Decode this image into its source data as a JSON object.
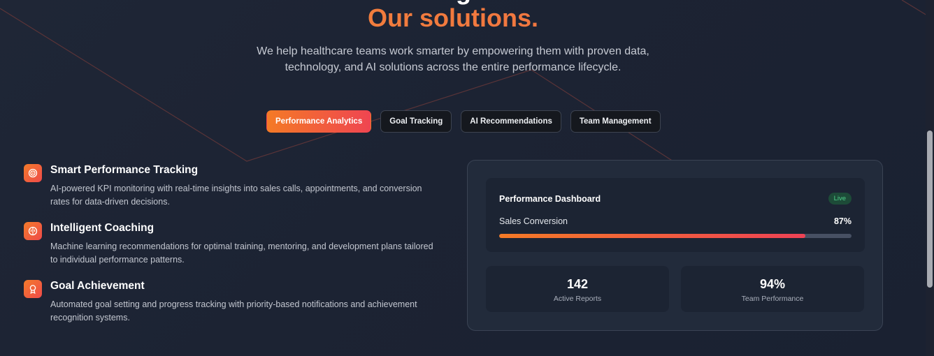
{
  "section": {
    "title": "Our solutions.",
    "subtitle": "We help healthcare teams work smarter by empowering them with proven data, technology, and AI solutions across the entire performance lifecycle."
  },
  "tabs": [
    {
      "label": "Performance Analytics",
      "active": true
    },
    {
      "label": "Goal Tracking",
      "active": false
    },
    {
      "label": "AI Recommendations",
      "active": false
    },
    {
      "label": "Team Management",
      "active": false
    }
  ],
  "features": [
    {
      "icon": "target-icon",
      "title": "Smart Performance Tracking",
      "description": "AI-powered KPI monitoring with real-time insights into sales calls, appointments, and conversion rates for data-driven decisions."
    },
    {
      "icon": "brain-icon",
      "title": "Intelligent Coaching",
      "description": "Machine learning recommendations for optimal training, mentoring, and development plans tailored to individual performance patterns."
    },
    {
      "icon": "award-icon",
      "title": "Goal Achievement",
      "description": "Automated goal setting and progress tracking with priority-based notifications and achievement recognition systems."
    }
  ],
  "dashboard": {
    "title": "Performance Dashboard",
    "badge": "Live",
    "metric_label": "Sales Conversion",
    "metric_value": "87%",
    "metric_fraction": 0.87,
    "stats": [
      {
        "value": "142",
        "label": "Active Reports"
      },
      {
        "value": "94%",
        "label": "Team Performance"
      }
    ]
  },
  "colors": {
    "accent_start": "#f47a26",
    "accent_end": "#ef4551",
    "background": "#1d2434",
    "live_badge": "#4fd08a"
  }
}
